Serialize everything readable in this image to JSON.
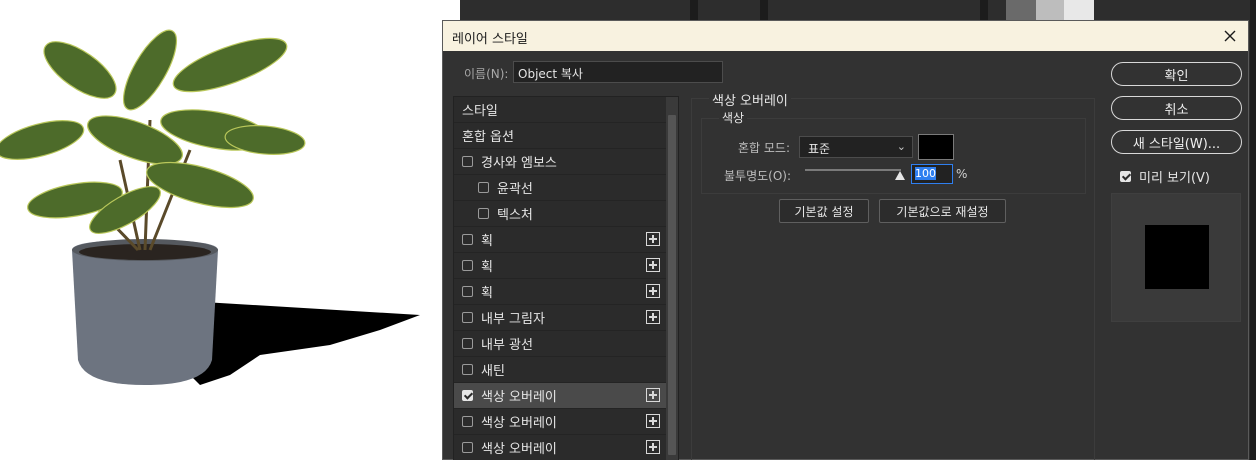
{
  "dialog": {
    "title": "레이어 스타일",
    "name_label": "이름(N):",
    "name_value": "Object 복사"
  },
  "styles": [
    {
      "label": "스타일",
      "checkbox": false,
      "checked": false,
      "plus": false,
      "indent": 0,
      "selected": false
    },
    {
      "label": "혼합 옵션",
      "checkbox": false,
      "checked": false,
      "plus": false,
      "indent": 0,
      "selected": false
    },
    {
      "label": "경사와 엠보스",
      "checkbox": true,
      "checked": false,
      "plus": false,
      "indent": 0,
      "selected": false
    },
    {
      "label": "윤곽선",
      "checkbox": true,
      "checked": false,
      "plus": false,
      "indent": 1,
      "selected": false
    },
    {
      "label": "텍스처",
      "checkbox": true,
      "checked": false,
      "plus": false,
      "indent": 1,
      "selected": false
    },
    {
      "label": "획",
      "checkbox": true,
      "checked": false,
      "plus": true,
      "indent": 0,
      "selected": false
    },
    {
      "label": "획",
      "checkbox": true,
      "checked": false,
      "plus": true,
      "indent": 0,
      "selected": false
    },
    {
      "label": "획",
      "checkbox": true,
      "checked": false,
      "plus": true,
      "indent": 0,
      "selected": false
    },
    {
      "label": "내부 그림자",
      "checkbox": true,
      "checked": false,
      "plus": true,
      "indent": 0,
      "selected": false
    },
    {
      "label": "내부 광선",
      "checkbox": true,
      "checked": false,
      "plus": false,
      "indent": 0,
      "selected": false
    },
    {
      "label": "새틴",
      "checkbox": true,
      "checked": false,
      "plus": false,
      "indent": 0,
      "selected": false
    },
    {
      "label": "색상 오버레이",
      "checkbox": true,
      "checked": true,
      "plus": true,
      "indent": 0,
      "selected": true
    },
    {
      "label": "색상 오버레이",
      "checkbox": true,
      "checked": false,
      "plus": true,
      "indent": 0,
      "selected": false
    },
    {
      "label": "색상 오버레이",
      "checkbox": true,
      "checked": false,
      "plus": true,
      "indent": 0,
      "selected": false
    }
  ],
  "overlay": {
    "section_title": "색상 오버레이",
    "group_title": "색상",
    "blend_label": "혼합 모드:",
    "blend_value": "표준",
    "opacity_label": "불투명도(O):",
    "opacity_value": "100",
    "opacity_unit": "%",
    "opacity_fraction": 1.0,
    "swatch_color": "#000000",
    "reset_default": "기본값 설정",
    "restore_default": "기본값으로 재설정"
  },
  "buttons": {
    "ok": "확인",
    "cancel": "취소",
    "new_style": "새 스타일(W)...",
    "preview": "미리 보기(V)",
    "preview_checked": true
  }
}
